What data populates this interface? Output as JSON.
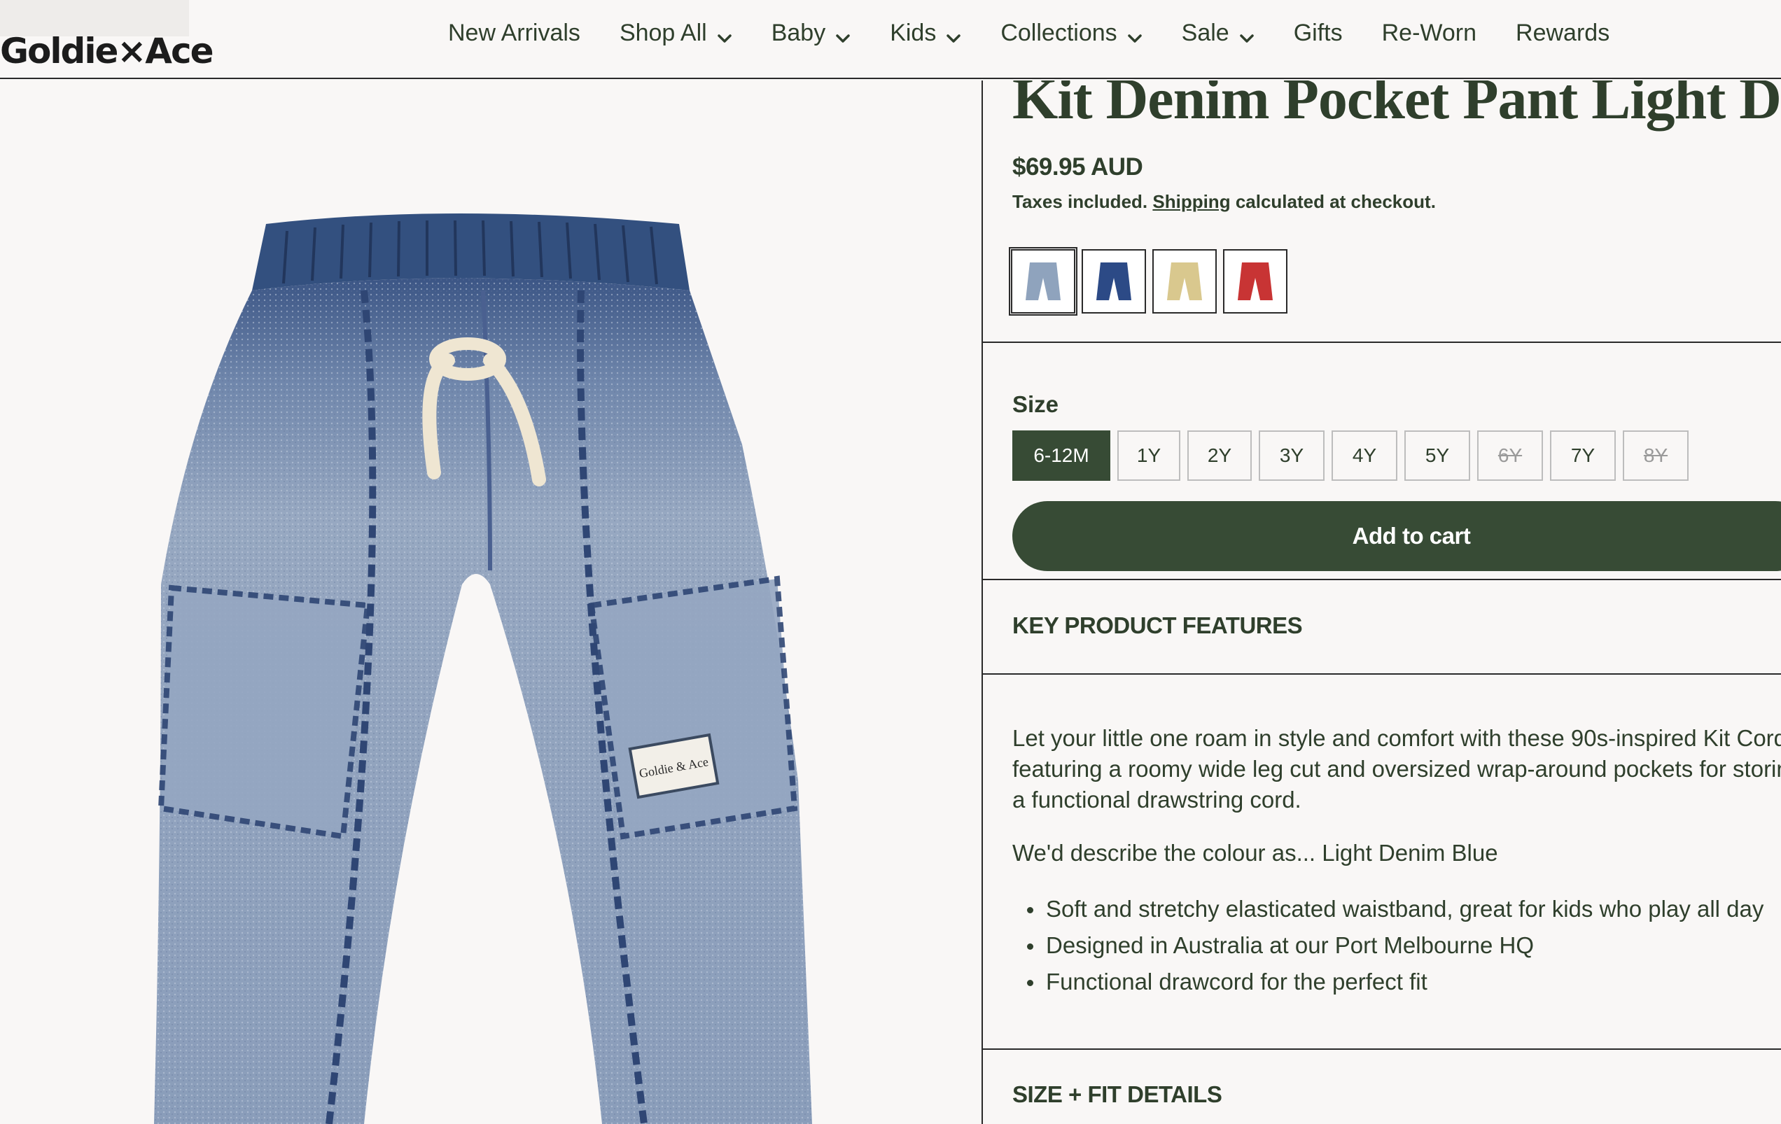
{
  "brand": {
    "logo_text": "Goldie×Ace"
  },
  "nav": {
    "items": [
      {
        "label": "New Arrivals",
        "has_dropdown": false
      },
      {
        "label": "Shop All",
        "has_dropdown": true
      },
      {
        "label": "Baby",
        "has_dropdown": true
      },
      {
        "label": "Kids",
        "has_dropdown": true
      },
      {
        "label": "Collections",
        "has_dropdown": true
      },
      {
        "label": "Sale",
        "has_dropdown": true
      },
      {
        "label": "Gifts",
        "has_dropdown": false
      },
      {
        "label": "Re-Worn",
        "has_dropdown": false
      },
      {
        "label": "Rewards",
        "has_dropdown": false
      }
    ]
  },
  "product": {
    "title": "Kit Denim Pocket Pant Light Denim",
    "price": "$69.95 AUD",
    "tax_prefix": "Taxes included.",
    "shipping_link": "Shipping",
    "tax_suffix": "calculated at checkout.",
    "patch_label": "Goldie & Ace",
    "swatches": [
      {
        "name": "light-denim",
        "color": "#8fa3bd",
        "active": true
      },
      {
        "name": "dark-denim",
        "color": "#2c4a86",
        "active": false
      },
      {
        "name": "stripe",
        "color": "#d9c88e",
        "active": false
      },
      {
        "name": "red",
        "color": "#c83434",
        "active": false
      }
    ],
    "size_label": "Size",
    "sizes": [
      {
        "label": "6-12M",
        "state": "selected"
      },
      {
        "label": "1Y",
        "state": "available"
      },
      {
        "label": "2Y",
        "state": "available"
      },
      {
        "label": "3Y",
        "state": "available"
      },
      {
        "label": "4Y",
        "state": "available"
      },
      {
        "label": "5Y",
        "state": "available"
      },
      {
        "label": "6Y",
        "state": "unavailable"
      },
      {
        "label": "7Y",
        "state": "available"
      },
      {
        "label": "8Y",
        "state": "unavailable"
      }
    ],
    "add_to_cart": "Add to cart",
    "features_heading": "KEY PRODUCT FEATURES",
    "description_lines": [
      "Let your little one roam in style and comfort with these 90s-inspired Kit Corduroy",
      "featuring a roomy wide leg cut and oversized wrap-around pockets for storing tre",
      "a functional drawstring cord."
    ],
    "colour_line": "We'd describe the colour as... Light Denim Blue",
    "bullets": [
      "Soft and stretchy elasticated waistband, great for kids who play all day",
      "Designed in Australia at our Port Melbourne HQ",
      "Functional drawcord for the perfect fit"
    ],
    "size_fit_heading": "SIZE + FIT DETAILS"
  },
  "colors": {
    "brand_green": "#374b35",
    "text_green": "#2f3f2c",
    "background": "#f9f7f6"
  }
}
